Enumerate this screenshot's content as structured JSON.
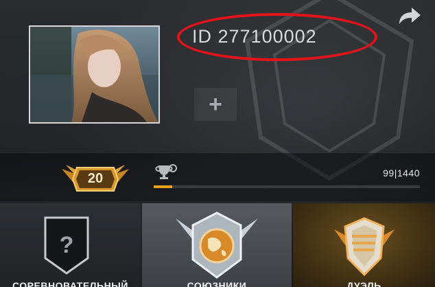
{
  "profile": {
    "player_id": "ID 277100002",
    "add_label": "+"
  },
  "level": {
    "value": "20",
    "progress_text": "99|1440",
    "progress_fraction": 0.069
  },
  "modes": [
    {
      "label": "СОРЕВНОВАТЕЛЬНЫЙ",
      "badge_glyph": "?"
    },
    {
      "label": "СОЮЗНИКИ"
    },
    {
      "label": "ДУЭЛЬ"
    }
  ],
  "colors": {
    "accent_orange": "#f0a01e",
    "annotation_red": "#e4131a",
    "badge_gold": "#d99a2b"
  },
  "icons": {
    "share": "share-arrow-icon",
    "trophy": "trophy-icon",
    "level_badge": "winged-level-badge-icon"
  }
}
